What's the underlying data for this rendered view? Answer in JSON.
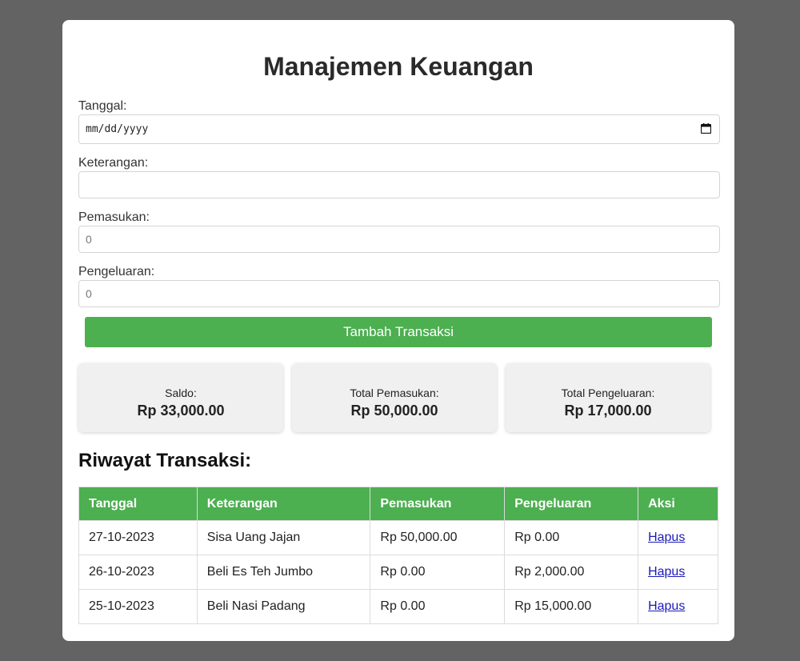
{
  "page": {
    "title": "Manajemen Keuangan"
  },
  "form": {
    "tanggal_label": "Tanggal:",
    "tanggal_placeholder": "mm/dd/yyyy",
    "keterangan_label": "Keterangan:",
    "keterangan_value": "",
    "pemasukan_label": "Pemasukan:",
    "pemasukan_value": "0",
    "pengeluaran_label": "Pengeluaran:",
    "pengeluaran_value": "0",
    "submit_label": "Tambah Transaksi"
  },
  "summary": {
    "saldo_label": "Saldo:",
    "saldo_value": "Rp 33,000.00",
    "pemasukan_label": "Total Pemasukan:",
    "pemasukan_value": "Rp 50,000.00",
    "pengeluaran_label": "Total Pengeluaran:",
    "pengeluaran_value": "Rp 17,000.00"
  },
  "history": {
    "title": "Riwayat Transaksi:",
    "columns": [
      "Tanggal",
      "Keterangan",
      "Pemasukan",
      "Pengeluaran",
      "Aksi"
    ],
    "rows": [
      {
        "tanggal": "27-10-2023",
        "keterangan": "Sisa Uang Jajan",
        "pemasukan": "Rp 50,000.00",
        "pengeluaran": "Rp 0.00",
        "aksi": "Hapus"
      },
      {
        "tanggal": "26-10-2023",
        "keterangan": "Beli Es Teh Jumbo",
        "pemasukan": "Rp 0.00",
        "pengeluaran": "Rp 2,000.00",
        "aksi": "Hapus"
      },
      {
        "tanggal": "25-10-2023",
        "keterangan": "Beli Nasi Padang",
        "pemasukan": "Rp 0.00",
        "pengeluaran": "Rp 15,000.00",
        "aksi": "Hapus"
      }
    ]
  },
  "colors": {
    "accent": "#4caf50",
    "background": "#636363",
    "link": "#1a1ab8"
  },
  "icons": {
    "date_picker": "calendar-icon"
  }
}
